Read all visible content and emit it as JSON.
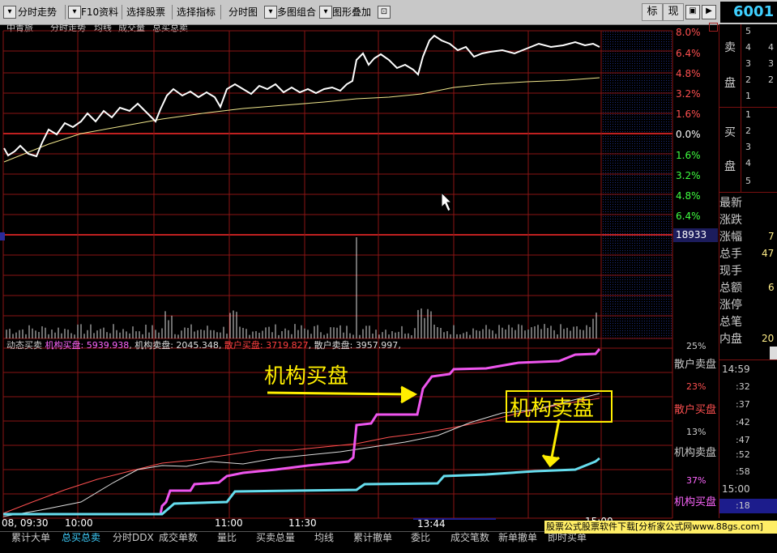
{
  "toolbar": {
    "items": [
      "分时走势",
      "F10资料",
      "选择股票",
      "选择指标",
      "分时图",
      "多图组合",
      "图形叠加"
    ],
    "btn_biao": "标",
    "btn_xian": "现"
  },
  "stock_code": "6001",
  "header": {
    "stock_name": "中青旅",
    "tabs": [
      "分时走势",
      "均线",
      "成交量",
      "总买总卖"
    ]
  },
  "price_axis": {
    "up": [
      "8.0%",
      "6.4%",
      "4.8%",
      "3.2%",
      "1.6%"
    ],
    "zero": "0.0%",
    "down": [
      "1.6%",
      "3.2%",
      "4.8%",
      "6.4%"
    ]
  },
  "volume_axis_value": "18933",
  "indicator": {
    "title": "动态买卖",
    "items": [
      {
        "label": "机构买盘",
        "value": "5939.938",
        "color": "#ff66ff"
      },
      {
        "label": "机构卖盘",
        "value": "2045.348",
        "color": "#e0e0e0"
      },
      {
        "label": "散户买盘",
        "value": "3719.827",
        "color": "#ff4040"
      },
      {
        "label": "散户卖盘",
        "value": "3957.997",
        "color": "#dddddd"
      }
    ]
  },
  "indicator_axis": {
    "pct": [
      "25%",
      "23%",
      "13%",
      "37%"
    ],
    "labels": [
      "散户卖盘",
      "散户买盘",
      "机构卖盘",
      "机构买盘"
    ]
  },
  "annotations": {
    "buy": "机构买盘",
    "sell": "机构卖盘"
  },
  "time_axis": {
    "labels": [
      "08, 09:30",
      "10:00",
      "11:00",
      "11:30"
    ],
    "cursor": "13:44",
    "end": "15:00"
  },
  "right_panel": {
    "sell_label_1": "卖",
    "sell_label_2": "盘",
    "buy_label_1": "买",
    "buy_label_2": "盘",
    "sell_levels": [
      "5",
      "4",
      "3",
      "2",
      "1"
    ],
    "buy_levels": [
      "1",
      "2",
      "3",
      "4",
      "5"
    ],
    "sell_values": [
      "",
      "4",
      "3",
      "2",
      ""
    ],
    "quote_labels": [
      "最新",
      "涨跌",
      "涨幅",
      "总手",
      "现手",
      "总额",
      "涨停",
      "总笔",
      "内盘"
    ],
    "quote_values": [
      "",
      "",
      "7",
      "47",
      "",
      "6",
      "",
      "",
      "20"
    ],
    "time_header": "14:59",
    "ticks": [
      ":32",
      ":37",
      ":42",
      ":47",
      ":52",
      ":58"
    ],
    "close_time": "15:00",
    "last_tick": ":18"
  },
  "bottom_tabs": [
    "累计大单",
    "总买总卖",
    "分时DDX",
    "成交单数",
    "量比",
    "买卖总量",
    "均线",
    "累计撤单",
    "委比",
    "成交笔数",
    "新单撤单",
    "即时买单"
  ],
  "ad_text": "股票公式股票软件下载[分析家公式网www.88gs.com]",
  "colors": {
    "grid": "#a01818",
    "price_line": "#ffffff",
    "avg_line": "#f0e68c",
    "up": "#ff4040",
    "down": "#40ff40",
    "annotation": "#ffff00",
    "inst_buy": "#ee55ee",
    "inst_sell": "#66ddee"
  }
}
